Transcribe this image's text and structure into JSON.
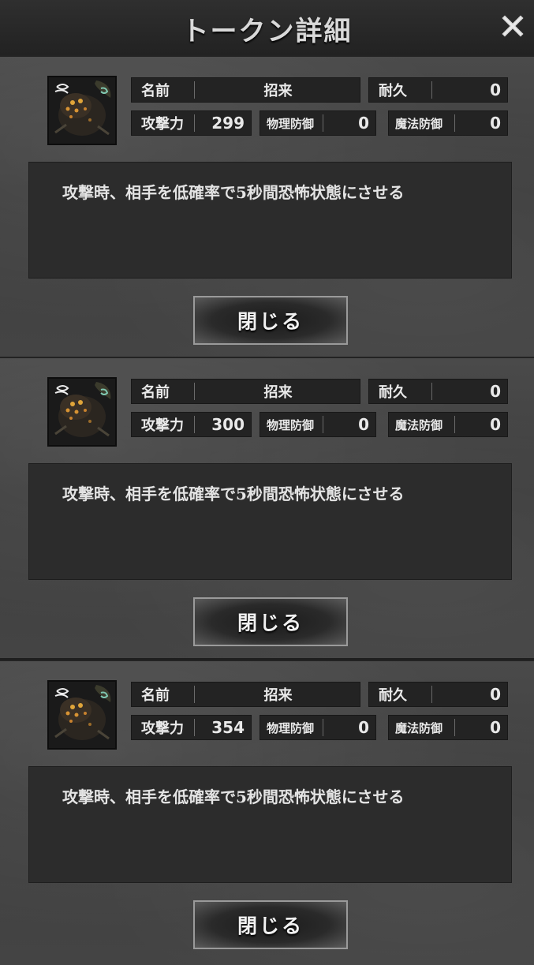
{
  "header": {
    "title": "トークン詳細",
    "close_icon": "close-icon"
  },
  "panels": [
    {
      "icon": "spider-token-portrait",
      "name_label": "名前",
      "name_value": "招来",
      "durability_label": "耐久",
      "durability_value": "0",
      "attack_label": "攻撃力",
      "attack_value": "299",
      "phys_def_label": "物理防御",
      "phys_def_value": "0",
      "mag_def_label": "魔法防御",
      "mag_def_value": "0",
      "description": "攻撃時、相手を低確率で5秒間恐怖状態にさせる",
      "close_button_label": "閉じる"
    },
    {
      "icon": "spider-token-portrait",
      "name_label": "名前",
      "name_value": "招来",
      "durability_label": "耐久",
      "durability_value": "0",
      "attack_label": "攻撃力",
      "attack_value": "300",
      "phys_def_label": "物理防御",
      "phys_def_value": "0",
      "mag_def_label": "魔法防御",
      "mag_def_value": "0",
      "description": "攻撃時、相手を低確率で5秒間恐怖状態にさせる",
      "close_button_label": "閉じる"
    },
    {
      "icon": "spider-token-portrait",
      "name_label": "名前",
      "name_value": "招来",
      "durability_label": "耐久",
      "durability_value": "0",
      "attack_label": "攻撃力",
      "attack_value": "354",
      "phys_def_label": "物理防御",
      "phys_def_value": "0",
      "mag_def_label": "魔法防御",
      "mag_def_value": "0",
      "description": "攻撃時、相手を低確率で5秒間恐怖状態にさせる",
      "close_button_label": "閉じる"
    }
  ]
}
